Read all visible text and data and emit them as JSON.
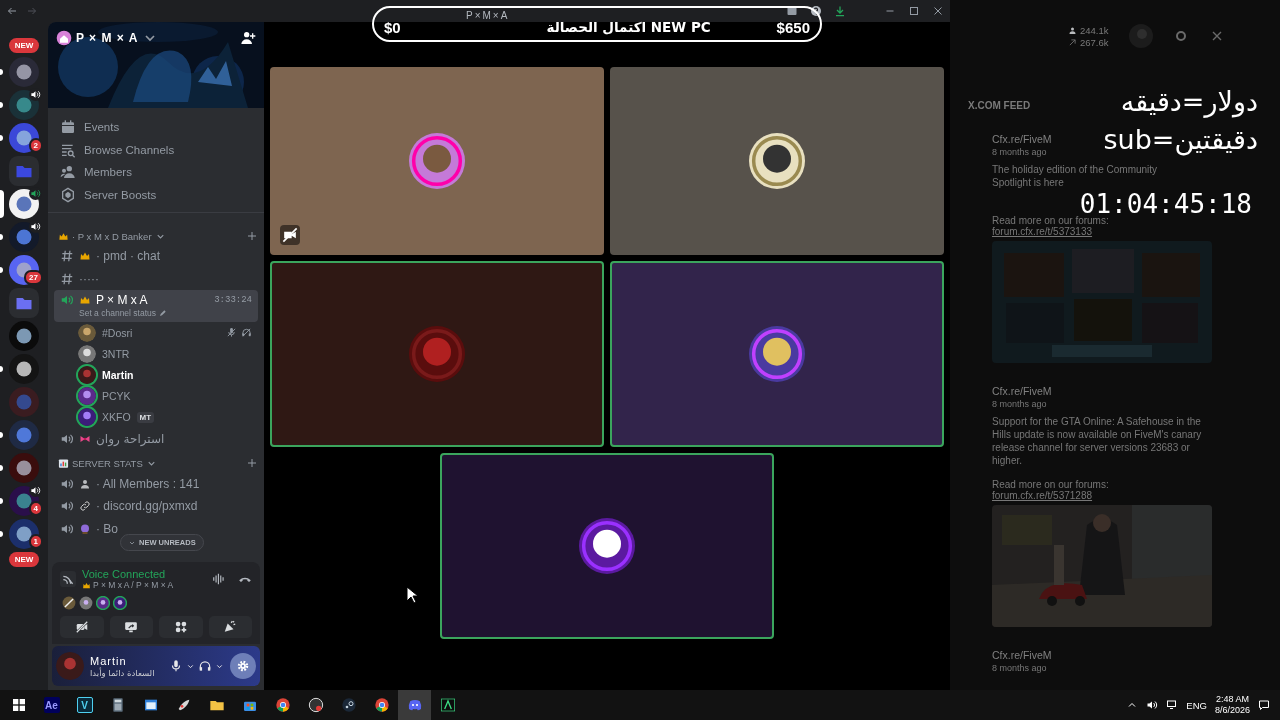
{
  "titlebar": {
    "title": "P×M×A"
  },
  "stream_overlay": {
    "goal_start": "$0",
    "goal_label": "اكتمال الحصالة NEW PC",
    "goal_end": "$650",
    "rate_dollar": "دولار=دقيقه",
    "rate_sub": "sub=دقيقتين",
    "timer": "01:04:45:18"
  },
  "server_rail": [
    {
      "kind": "new",
      "label": "NEW"
    },
    {
      "kind": "server",
      "selected": false,
      "unread": true,
      "voice": false
    },
    {
      "kind": "server",
      "selected": false,
      "unread": true,
      "voice": true
    },
    {
      "kind": "server",
      "selected": false,
      "unread": true,
      "voice": false,
      "badge": "2"
    },
    {
      "kind": "folder"
    },
    {
      "kind": "server",
      "selected": true,
      "unread": false,
      "voice": true
    },
    {
      "kind": "server",
      "selected": false,
      "unread": true,
      "voice": true
    },
    {
      "kind": "server",
      "selected": false,
      "unread": true,
      "voice": false,
      "badge": "27"
    },
    {
      "kind": "folder"
    },
    {
      "kind": "server",
      "selected": false,
      "unread": false,
      "voice": false
    },
    {
      "kind": "server",
      "selected": false,
      "unread": true,
      "voice": false
    },
    {
      "kind": "server",
      "selected": false,
      "unread": false,
      "voice": false
    },
    {
      "kind": "server",
      "selected": false,
      "unread": true,
      "voice": false
    },
    {
      "kind": "server",
      "selected": false,
      "unread": true,
      "voice": false
    },
    {
      "kind": "server",
      "selected": false,
      "unread": true,
      "voice": true,
      "badge": "4"
    },
    {
      "kind": "server",
      "selected": false,
      "unread": true,
      "voice": false,
      "badge": "1"
    },
    {
      "kind": "new",
      "label": "NEW"
    }
  ],
  "server_header": {
    "name": "P × M × A"
  },
  "menu": [
    {
      "kind": "events",
      "label": "Events"
    },
    {
      "kind": "browse",
      "label": "Browse Channels"
    },
    {
      "kind": "members",
      "label": "Members"
    },
    {
      "kind": "boosts",
      "label": "Server Boosts"
    }
  ],
  "categories": [
    {
      "name": "· P x M x D Banker",
      "channels": [
        {
          "kind": "text",
          "name": "· pmd · chat"
        },
        {
          "kind": "text",
          "name": "·····"
        },
        {
          "kind": "voice",
          "name": "P × M x A",
          "selected": true,
          "connected": true,
          "time": "3:33:24",
          "status": "Set a channel status",
          "members": [
            {
              "name": "#Dosri",
              "self": false,
              "speaking": false,
              "muted": true
            },
            {
              "name": "3NTR",
              "self": false,
              "speaking": false,
              "muted": false
            },
            {
              "name": "Martin",
              "self": true,
              "speaking": true,
              "muted": false
            },
            {
              "name": "PCYK",
              "self": false,
              "speaking": true,
              "muted": false
            },
            {
              "name": "XKFO",
              "self": false,
              "speaking": true,
              "muted": false,
              "tag": "MT"
            }
          ]
        },
        {
          "kind": "voice",
          "name": "استراحة روان",
          "selected": false,
          "connected": false
        }
      ]
    },
    {
      "name": "SERVER STATS",
      "channels": [
        {
          "kind": "voice",
          "name": "· All Members : 141",
          "selected": false,
          "connected": false
        },
        {
          "kind": "voice",
          "name": "· discord.gg/pxmxd",
          "selected": false,
          "connected": false
        },
        {
          "kind": "voice",
          "name": "· Bo",
          "selected": false,
          "connected": false
        }
      ]
    }
  ],
  "new_unreads": "NEW UNREADS",
  "voice_panel": {
    "status": "Voice Connected",
    "location": "P × M x A / P × M × A",
    "participants": [
      {
        "muted": true,
        "speaking": false
      },
      {
        "muted": false,
        "speaking": false
      },
      {
        "muted": false,
        "speaking": true
      },
      {
        "muted": false,
        "speaking": true
      }
    ],
    "actions": [
      {
        "kind": "camera-off"
      },
      {
        "kind": "screen-share"
      },
      {
        "kind": "activities"
      },
      {
        "kind": "soundboard"
      }
    ]
  },
  "user_panel": {
    "name": "Martin",
    "status": "السعادة دائما وأبدا"
  },
  "tiles": [
    {
      "color": "#7e6550",
      "speaking": false,
      "video_off": true
    },
    {
      "color": "#57524b",
      "speaking": false,
      "video_off": false
    },
    {
      "color": "#2f1814",
      "speaking": true,
      "video_off": false
    },
    {
      "color": "#32244b",
      "speaking": true,
      "video_off": false
    },
    {
      "color": "#1f1230",
      "speaking": true,
      "video_off": false
    }
  ],
  "right_panel": {
    "followers": "244.1k",
    "views": "267.6k",
    "feed_title": "X.COM FEED",
    "posts": [
      {
        "author": "Cfx.re/FiveM",
        "time": "8 months ago",
        "body": "The holiday edition of the Community Spotlight is here",
        "more": "Read more on our forums:",
        "link": "forum.cfx.re/t/5373133",
        "picture": true
      },
      {
        "author": "Cfx.re/FiveM",
        "time": "8 months ago",
        "body": "Support for the GTA Online: A Safehouse in the Hills update is now available on FiveM's canary release channel for server versions 23683 or higher.",
        "more": "Read more on our forums:",
        "link": "forum.cfx.re/t/5371288",
        "picture": true
      },
      {
        "author": "Cfx.re/FiveM",
        "time": "8 months ago",
        "picture": false
      }
    ]
  },
  "taskbar": {
    "apps": [
      {
        "kind": "windows",
        "selected": false
      },
      {
        "kind": "ae",
        "label": "Ae",
        "selected": false
      },
      {
        "kind": "v",
        "label": "V",
        "selected": false
      },
      {
        "kind": "calculator",
        "selected": false
      },
      {
        "kind": "window",
        "selected": false
      },
      {
        "kind": "tool",
        "selected": false
      },
      {
        "kind": "folder",
        "selected": false
      },
      {
        "kind": "store",
        "selected": false
      },
      {
        "kind": "chrome",
        "selected": false
      },
      {
        "kind": "obs",
        "selected": false
      },
      {
        "kind": "steam",
        "selected": false
      },
      {
        "kind": "chrome",
        "selected": false
      },
      {
        "kind": "discord",
        "selected": true
      },
      {
        "kind": "terminal",
        "selected": false
      }
    ],
    "language": "ENG",
    "time": "2:48 AM",
    "date": "8/6/2026"
  }
}
